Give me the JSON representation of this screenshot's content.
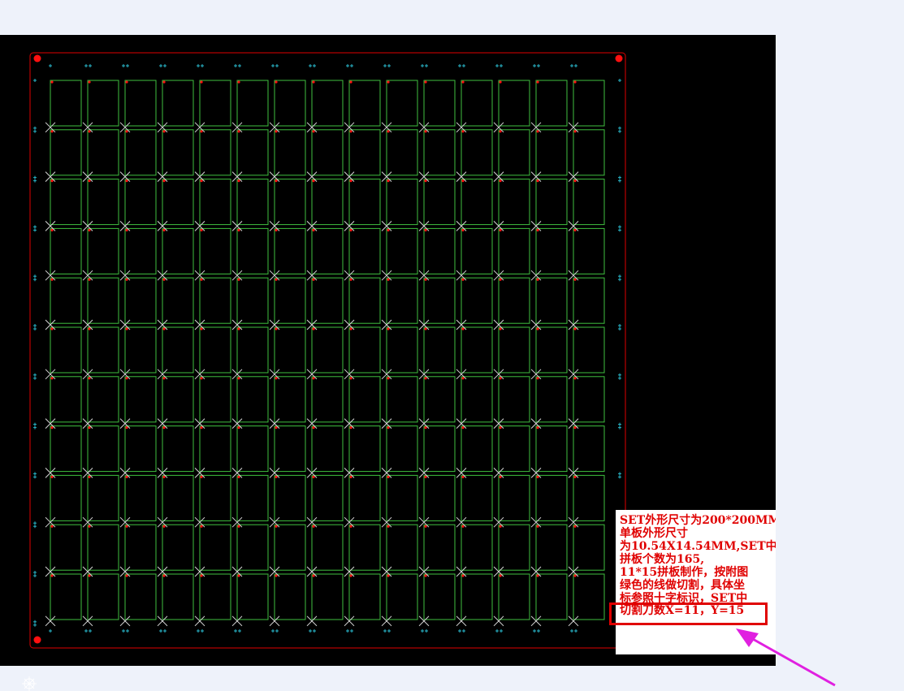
{
  "canvas": {
    "colors": {
      "background": "#000000",
      "outline": "#e00000",
      "grid": "#3fbf3f",
      "cross": "#d8d8d8",
      "marker": "#29b6c9",
      "fiducial": "#ff1010",
      "annotation": "#e00000",
      "arrow": "#e020e0"
    },
    "panel_grid": {
      "columns": 15,
      "rows": 11
    }
  },
  "note": {
    "lines": [
      "SET外形尺寸为200*200MM",
      "单板外形尺寸",
      "为10.54X14.54MM,SET中",
      "拼板个数为165,",
      "11*15拼板制作，按附图",
      "绿色的线做切割，具体坐",
      "标参照十字标识，SET中",
      "切割刀数X=11，Y=15"
    ]
  },
  "icons": {
    "origin": "origin-crosshair-icon",
    "callout": "pointer-arrow-icon"
  }
}
